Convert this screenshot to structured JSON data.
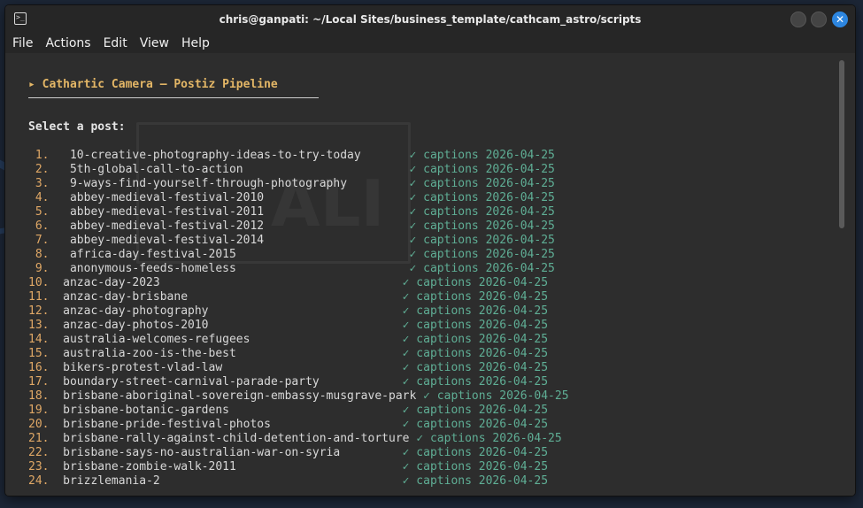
{
  "window": {
    "title": "chris@ganpati: ~/Local Sites/business_template/cathcam_astro/scripts",
    "close_glyph": "✕"
  },
  "menu": [
    "File",
    "Actions",
    "Edit",
    "View",
    "Help"
  ],
  "terminal": {
    "header": "▸ Cathartic Camera — Postiz Pipeline",
    "prompt": "Select a post:",
    "status_label": "✓ captions",
    "status_date": "2026-04-25",
    "status_color": "#5fae95",
    "header_color": "#e3b666",
    "posts": [
      {
        "n": "1.",
        "name": "10-creative-photography-ideas-to-try-today"
      },
      {
        "n": "2.",
        "name": "5th-global-call-to-action"
      },
      {
        "n": "3.",
        "name": "9-ways-find-yourself-through-photography"
      },
      {
        "n": "4.",
        "name": "abbey-medieval-festival-2010"
      },
      {
        "n": "5.",
        "name": "abbey-medieval-festival-2011"
      },
      {
        "n": "6.",
        "name": "abbey-medieval-festival-2012"
      },
      {
        "n": "7.",
        "name": "abbey-medieval-festival-2014"
      },
      {
        "n": "8.",
        "name": "africa-day-festival-2015"
      },
      {
        "n": "9.",
        "name": "anonymous-feeds-homeless"
      },
      {
        "n": "10.",
        "name": "anzac-day-2023"
      },
      {
        "n": "11.",
        "name": "anzac-day-brisbane"
      },
      {
        "n": "12.",
        "name": "anzac-day-photography"
      },
      {
        "n": "13.",
        "name": "anzac-day-photos-2010"
      },
      {
        "n": "14.",
        "name": "australia-welcomes-refugees"
      },
      {
        "n": "15.",
        "name": "australia-zoo-is-the-best"
      },
      {
        "n": "16.",
        "name": "bikers-protest-vlad-law"
      },
      {
        "n": "17.",
        "name": "boundary-street-carnival-parade-party"
      },
      {
        "n": "18.",
        "name": "brisbane-aboriginal-sovereign-embassy-musgrave-park"
      },
      {
        "n": "19.",
        "name": "brisbane-botanic-gardens"
      },
      {
        "n": "20.",
        "name": "brisbane-pride-festival-photos"
      },
      {
        "n": "21.",
        "name": "brisbane-rally-against-child-detention-and-torture"
      },
      {
        "n": "22.",
        "name": "brisbane-says-no-australian-war-on-syria"
      },
      {
        "n": "23.",
        "name": "brisbane-zombie-walk-2011"
      },
      {
        "n": "24.",
        "name": "brizzlemania-2"
      }
    ]
  }
}
